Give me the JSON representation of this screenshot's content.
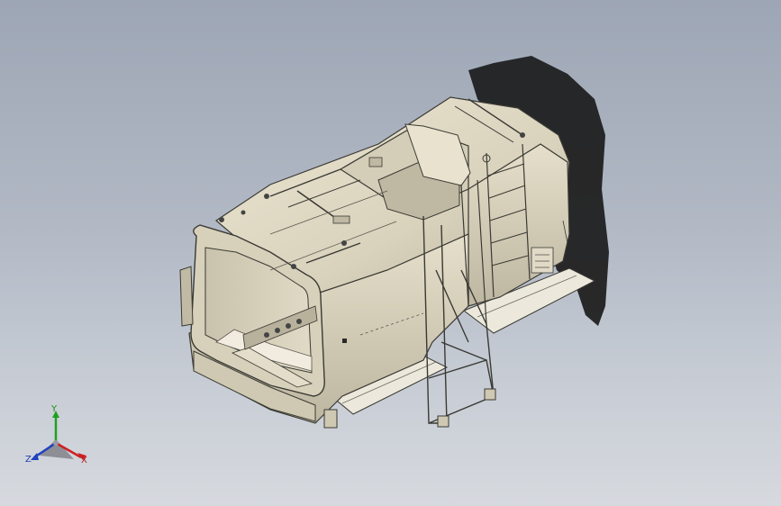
{
  "viewport": {
    "background_top": "#9da6b5",
    "background_bottom": "#d6d9de"
  },
  "model": {
    "body_color": "#ddd6c1",
    "shade_color": "#a9a28e",
    "edge_color": "#3a3a34",
    "shadow_color": "#1e1e1e"
  },
  "triad": {
    "x_label": "X",
    "y_label": "Y",
    "z_label": "Z",
    "x_color": "#cc2020",
    "y_color": "#20a020",
    "z_color": "#2040c0"
  }
}
